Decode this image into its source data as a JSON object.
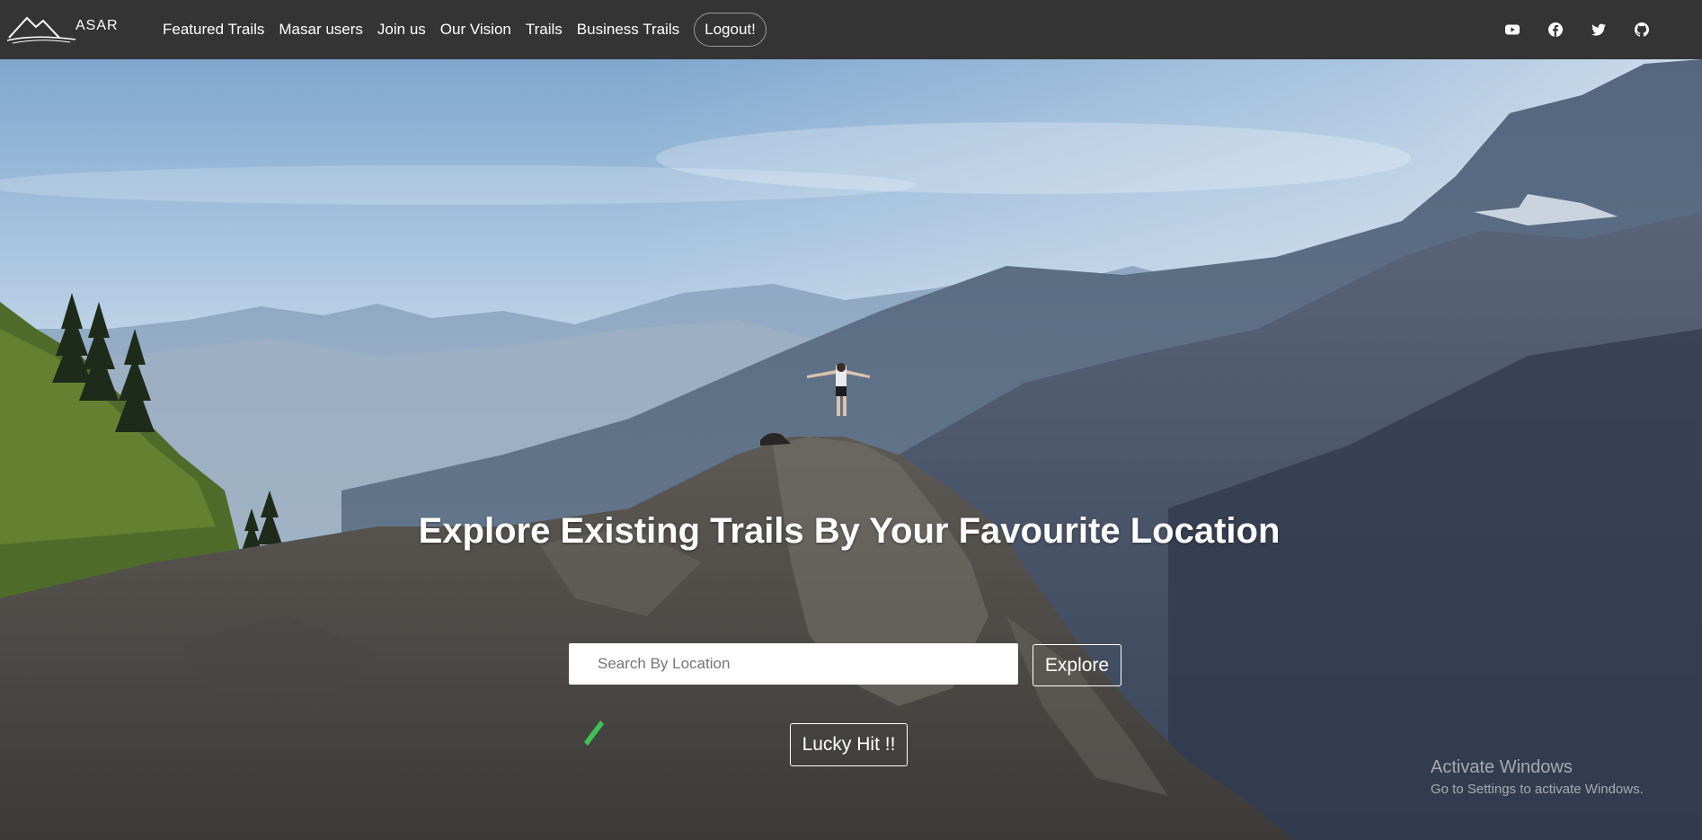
{
  "brand": {
    "logo_text": "ASAR"
  },
  "nav": {
    "items": [
      {
        "label": "Featured Trails"
      },
      {
        "label": "Masar users"
      },
      {
        "label": "Join us"
      },
      {
        "label": "Our Vision"
      },
      {
        "label": "Trails"
      },
      {
        "label": "Business Trails"
      }
    ],
    "logout_label": "Logout!"
  },
  "social": [
    "youtube-icon",
    "facebook-icon",
    "twitter-icon",
    "github-icon"
  ],
  "hero": {
    "title": "Explore Existing Trails By Your Favourite Location",
    "search_placeholder": "Search By Location",
    "explore_label": "Explore",
    "lucky_label": "Lucky Hit !!"
  },
  "watermark": {
    "line1": "Activate Windows",
    "line2": "Go to Settings to activate Windows."
  },
  "colors": {
    "navbar": "#343434",
    "sky": "#aac7e0",
    "mountain": "#4b5970"
  }
}
